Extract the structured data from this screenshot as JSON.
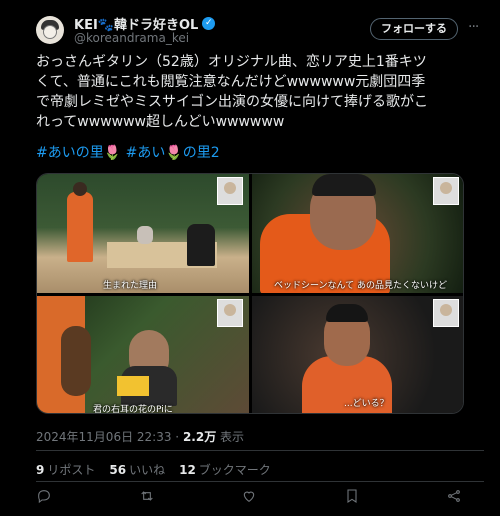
{
  "author": {
    "display_name": "KEI🐾韓ドラ好きOL",
    "handle": "@koreandrama_kei",
    "verified": true
  },
  "follow_label": "フォローする",
  "tweet": {
    "text": "おっさんギタリン（52歳）オリジナル曲、恋リア史上1番キツ\nくて、普通にこれも閲覧注意なんだけどwwwwww元劇団四季\nで帝劇レミゼやミスサイゴン出演の女優に向けて捧げる歌がこ\nれってwwwwww超しんどいwwwwww",
    "hashtags": "#あいの里🌷 #あい🌷の里2"
  },
  "media": {
    "captions": [
      "生まれた理由",
      "ベッドシーンなんて あの品見たくないけど",
      "君の右耳の花のPiに",
      "...どいる？"
    ]
  },
  "meta": {
    "date": "2024年11月06日 22:33",
    "views_count": "2.2万",
    "views_label": "表示"
  },
  "stats": {
    "retweets_count": "9",
    "retweets_label": "リポスト",
    "likes_count": "56",
    "likes_label": "いいね",
    "bookmarks_count": "12",
    "bookmarks_label": "ブックマーク"
  },
  "colors": {
    "accent": "#1d9bf0",
    "muted": "#71767b",
    "bg": "#000000"
  },
  "icons": [
    "more-icon",
    "reply-icon",
    "retweet-icon",
    "like-icon",
    "bookmark-icon",
    "share-icon"
  ]
}
